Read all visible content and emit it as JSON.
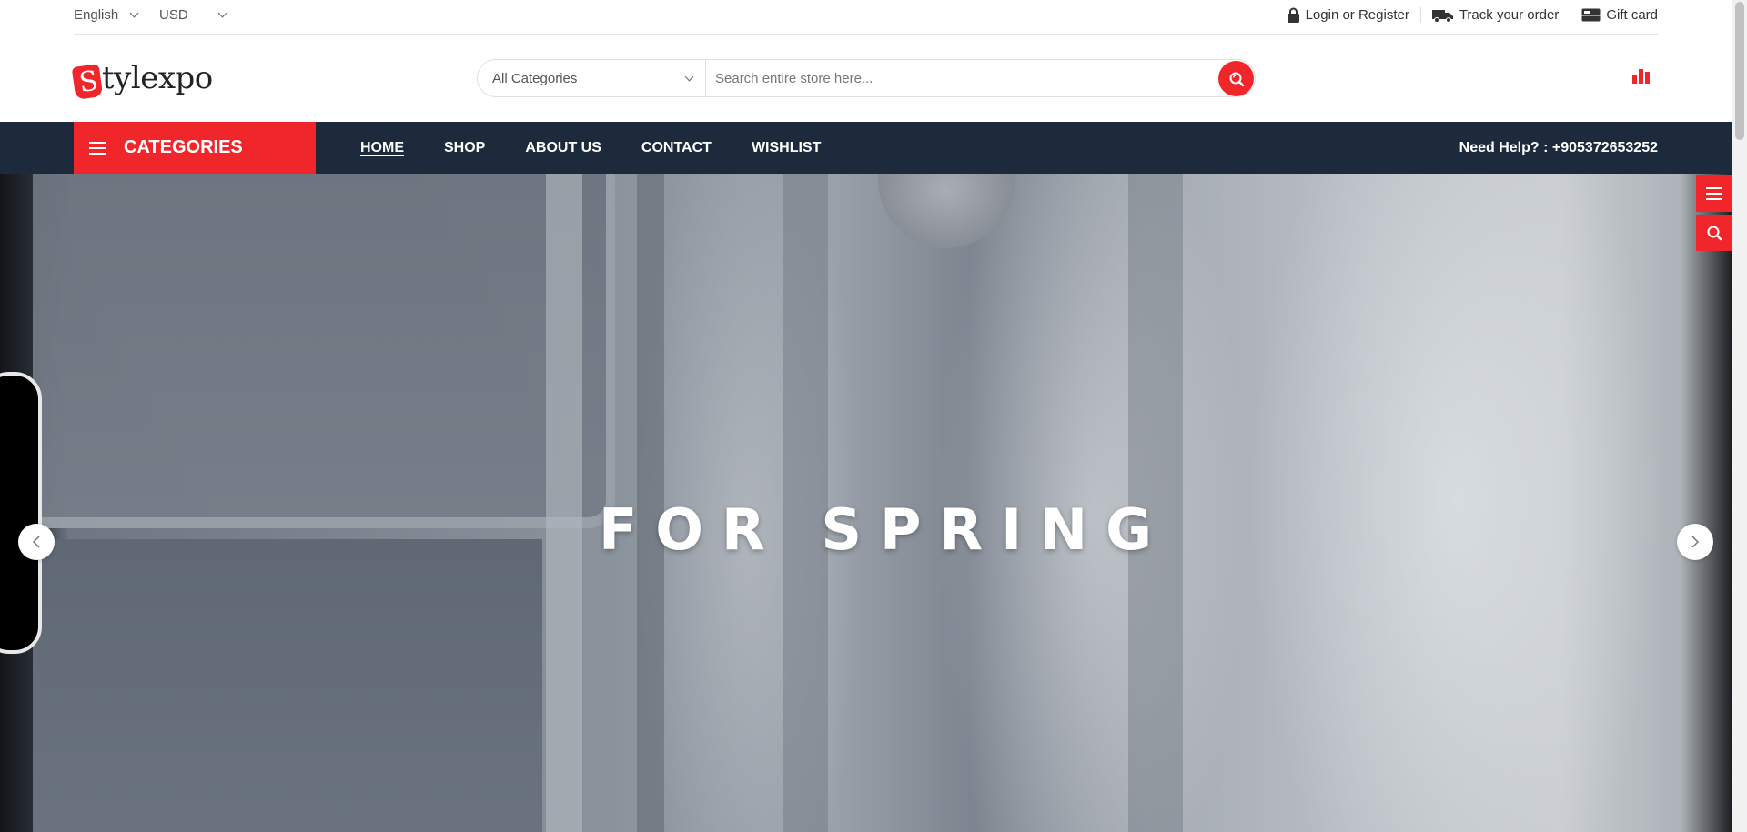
{
  "topbar": {
    "language": "English",
    "currency": "USD",
    "login_label": "Login or Register",
    "track_label": "Track your order",
    "giftcard_label": "Gift card"
  },
  "header": {
    "logo_tag_letter": "S",
    "logo_text": "tylexpo",
    "category_select": "All Categories",
    "search_placeholder": "Search entire store here..."
  },
  "nav": {
    "categories_label": "CATEGORIES",
    "items": [
      {
        "label": "HOME",
        "active": true
      },
      {
        "label": "SHOP",
        "active": false
      },
      {
        "label": "ABOUT US",
        "active": false
      },
      {
        "label": "CONTACT",
        "active": false
      },
      {
        "label": "WISHLIST",
        "active": false
      }
    ],
    "help_text": "Need Help? : +905372653252"
  },
  "hero": {
    "title": "FOR SPRING"
  },
  "colors": {
    "accent": "#f0262b",
    "nav_bg": "#1c2a3b"
  },
  "icons": {
    "lock": "lock-icon",
    "truck": "truck-icon",
    "gift": "gift-card-icon",
    "search": "search-icon",
    "compare": "bar-chart-icon",
    "menu": "hamburger-icon"
  }
}
